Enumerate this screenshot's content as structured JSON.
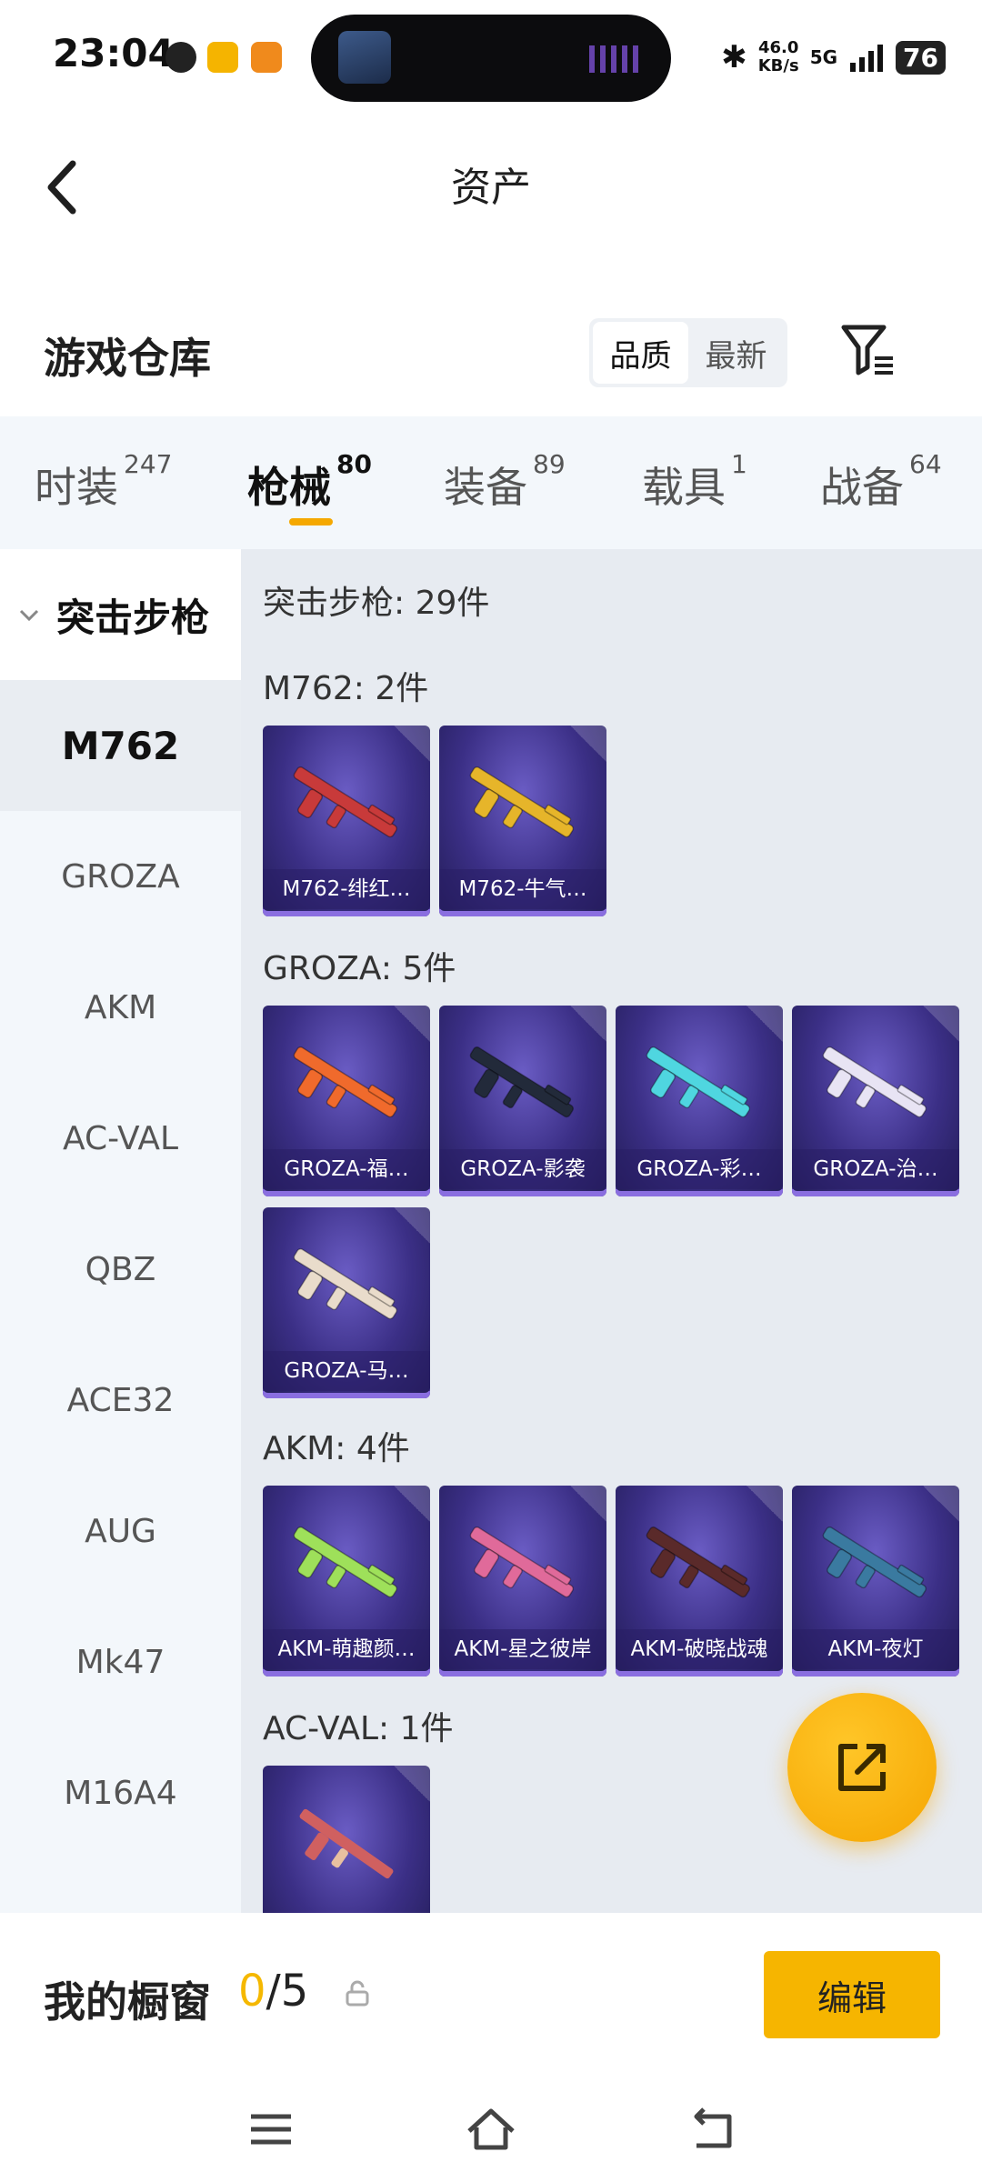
{
  "status_bar": {
    "time": "23:04",
    "net_speed_value": "46.0",
    "net_speed_unit": "KB/s",
    "network": "5G",
    "battery": "76"
  },
  "header": {
    "title": "资产"
  },
  "warehouse": {
    "title": "游戏仓库",
    "sort_options": [
      "品质",
      "最新"
    ],
    "active_sort": "品质"
  },
  "tabs": [
    {
      "label": "时装",
      "count": "247"
    },
    {
      "label": "枪械",
      "count": "80",
      "active": true
    },
    {
      "label": "装备",
      "count": "89"
    },
    {
      "label": "载具",
      "count": "1"
    },
    {
      "label": "战备",
      "count": "64"
    }
  ],
  "sidebar": {
    "group": "突击步枪",
    "items": [
      "M762",
      "GROZA",
      "AKM",
      "AC-VAL",
      "QBZ",
      "ACE32",
      "AUG",
      "Mk47",
      "M16A4"
    ],
    "active": "M762"
  },
  "content": {
    "summary": "突击步枪: 29件",
    "sections": [
      {
        "title": "M762: 2件",
        "items": [
          "M762-绯红…",
          "M762-牛气…"
        ]
      },
      {
        "title": "GROZA: 5件",
        "items": [
          "GROZA-福…",
          "GROZA-影袭",
          "GROZA-彩…",
          "GROZA-治…",
          "GROZA-马…"
        ]
      },
      {
        "title": "AKM: 4件",
        "items": [
          "AKM-萌趣颜…",
          "AKM-星之彼岸",
          "AKM-破晓战魂",
          "AKM-夜灯"
        ]
      },
      {
        "title": "AC-VAL: 1件",
        "items": [
          ""
        ]
      }
    ],
    "gun_colors": {
      "M762-绯红…": "#c83a3a",
      "M762-牛气…": "#e6b52a",
      "GROZA-福…": "#f06a2c",
      "GROZA-影袭": "#222a3a",
      "GROZA-彩…": "#4fd6e0",
      "GROZA-治…": "#e8e4f4",
      "GROZA-马…": "#e9dccb",
      "AKM-萌趣颜…": "#9ee05a",
      "AKM-星之彼岸": "#e06a9a",
      "AKM-破晓战魂": "#5a2a2a",
      "AKM-夜灯": "#3a7aa0"
    }
  },
  "showcase": {
    "title": "我的橱窗",
    "current": "0",
    "total": "/5",
    "edit_label": "编辑"
  },
  "colors": {
    "accent": "#f6b500",
    "card_bg": "#3b2f86"
  }
}
